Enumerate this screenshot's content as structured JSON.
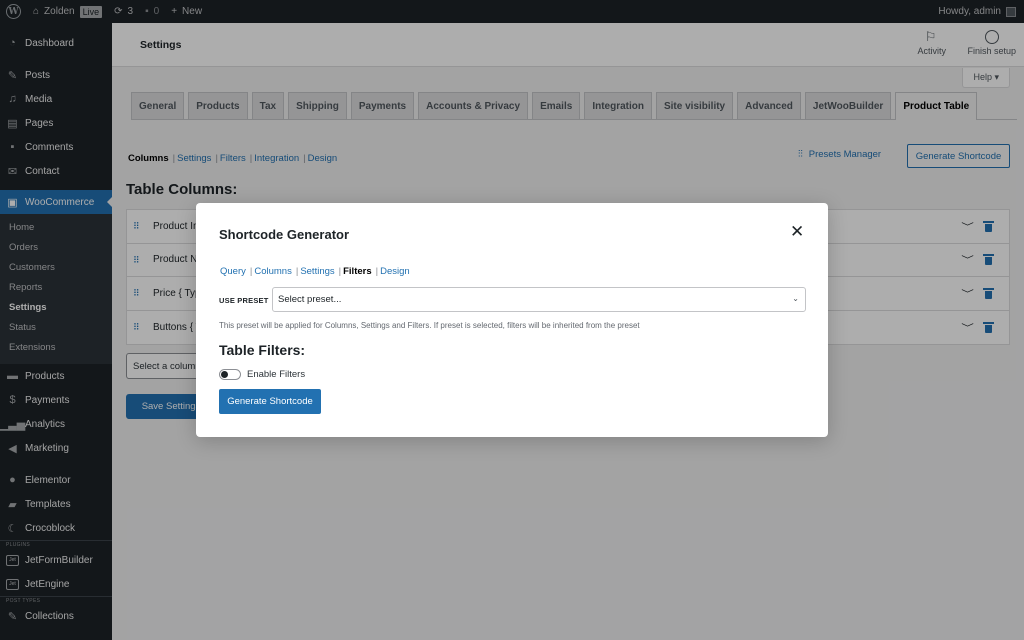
{
  "adminbar": {
    "site_name": "Zolden",
    "live_badge": "Live",
    "updates_count": "3",
    "comments_count": "0",
    "new_label": "New",
    "greeting": "Howdy, admin"
  },
  "sidebar": {
    "items": [
      {
        "label": "Dashboard",
        "icon": "dashboard-icon"
      },
      {
        "label": "Posts",
        "icon": "pin-icon"
      },
      {
        "label": "Media",
        "icon": "media-icon"
      },
      {
        "label": "Pages",
        "icon": "pages-icon"
      },
      {
        "label": "Comments",
        "icon": "comment-icon"
      },
      {
        "label": "Contact",
        "icon": "mail-icon"
      },
      {
        "label": "WooCommerce",
        "icon": "woo-icon"
      }
    ],
    "woo_submenu": [
      "Home",
      "Orders",
      "Customers",
      "Reports",
      "Settings",
      "Status",
      "Extensions"
    ],
    "woo_current": "Settings",
    "items2": [
      {
        "label": "Products",
        "icon": "archive-icon"
      },
      {
        "label": "Payments",
        "icon": "dollar-icon"
      },
      {
        "label": "Analytics",
        "icon": "chart-bar-icon"
      },
      {
        "label": "Marketing",
        "icon": "megaphone-icon"
      },
      {
        "label": "Elementor",
        "icon": "elementor-icon"
      },
      {
        "label": "Templates",
        "icon": "folder-icon"
      },
      {
        "label": "Crocoblock",
        "icon": "crocoblock-icon"
      }
    ],
    "plugins_sep": "PLUGINS",
    "items3": [
      {
        "label": "JetFormBuilder",
        "icon": "jet-icon"
      },
      {
        "label": "JetEngine",
        "icon": "jet-icon"
      }
    ],
    "post_types_sep": "POST TYPES",
    "items4": [
      {
        "label": "Collections",
        "icon": "pin-icon"
      }
    ]
  },
  "header": {
    "title": "Settings",
    "activity_label": "Activity",
    "finish_setup_label": "Finish setup",
    "help_label": "Help ▾"
  },
  "tabs": [
    "General",
    "Products",
    "Tax",
    "Shipping",
    "Payments",
    "Accounts & Privacy",
    "Emails",
    "Integration",
    "Site visibility",
    "Advanced",
    "JetWooBuilder",
    "Product Table"
  ],
  "active_tab": "Product Table",
  "subnav": {
    "items": [
      "Columns",
      "Settings",
      "Filters",
      "Integration",
      "Design"
    ],
    "current": "Columns"
  },
  "presets_manager_label": "Presets Manager",
  "generate_shortcode_label": "Generate Shortcode",
  "table_columns": {
    "title": "Table Columns:",
    "rows": [
      "Product Image",
      "Product Name",
      "Price { Type",
      "Buttons { Type"
    ],
    "select_placeholder": "Select a column",
    "save_label": "Save Settings"
  },
  "modal": {
    "title": "Shortcode Generator",
    "tabs": [
      "Query",
      "Columns",
      "Settings",
      "Filters",
      "Design"
    ],
    "current_tab": "Filters",
    "preset_label": "USE PRESET",
    "preset_value": "Select preset...",
    "preset_description": "This preset will be applied for Columns, Settings and Filters. If preset is selected, filters will be inherited from the preset",
    "filters_title": "Table Filters:",
    "enable_filters_label": "Enable Filters",
    "enable_filters_on": false,
    "generate_label": "Generate Shortcode"
  },
  "colors": {
    "accent": "#2271b1",
    "admin_dark": "#1d2327"
  }
}
